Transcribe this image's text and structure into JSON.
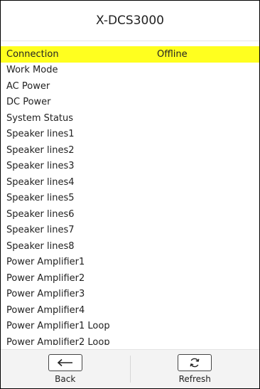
{
  "header": {
    "title": "X-DCS3000"
  },
  "rows": [
    {
      "label": "Connection",
      "value": "Offline"
    },
    {
      "label": "Work Mode",
      "value": ""
    },
    {
      "label": "AC Power",
      "value": ""
    },
    {
      "label": "DC Power",
      "value": ""
    },
    {
      "label": "System Status",
      "value": ""
    },
    {
      "label": "Speaker lines1",
      "value": ""
    },
    {
      "label": "Speaker lines2",
      "value": ""
    },
    {
      "label": "Speaker lines3",
      "value": ""
    },
    {
      "label": "Speaker lines4",
      "value": ""
    },
    {
      "label": "Speaker lines5",
      "value": ""
    },
    {
      "label": "Speaker lines6",
      "value": ""
    },
    {
      "label": "Speaker lines7",
      "value": ""
    },
    {
      "label": "Speaker lines8",
      "value": ""
    },
    {
      "label": "Power Amplifier1",
      "value": ""
    },
    {
      "label": "Power Amplifier2",
      "value": ""
    },
    {
      "label": "Power Amplifier3",
      "value": ""
    },
    {
      "label": "Power Amplifier4",
      "value": ""
    },
    {
      "label": "Power Amplifier1 Loop",
      "value": ""
    },
    {
      "label": "Power Amplifier2 Loop",
      "value": ""
    }
  ],
  "footer": {
    "back_label": "Back",
    "refresh_label": "Refresh"
  },
  "colors": {
    "highlight": "#ffff1f"
  },
  "icons": {
    "back": "left-arrow-icon",
    "refresh": "refresh-icon"
  }
}
